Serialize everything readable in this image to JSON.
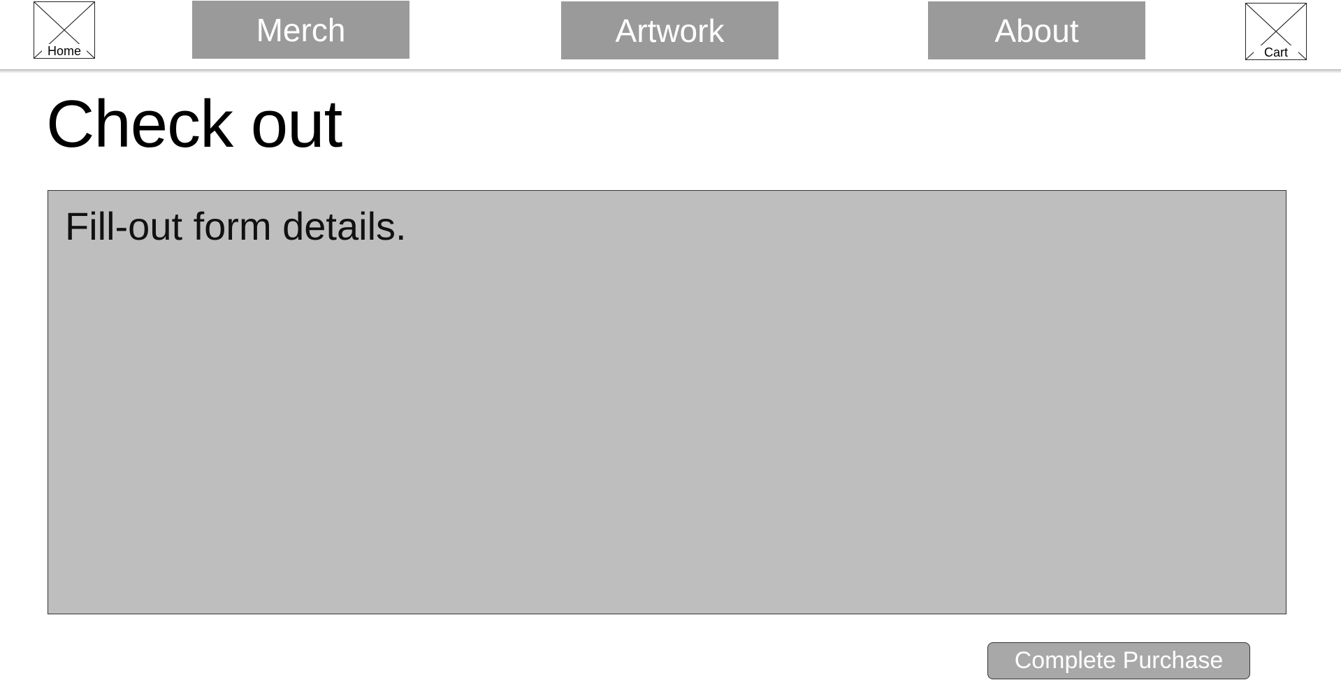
{
  "header": {
    "home_label": "Home",
    "cart_label": "Cart",
    "nav": {
      "merch": "Merch",
      "artwork": "Artwork",
      "about": "About"
    }
  },
  "main": {
    "title": "Check out",
    "form_panel": {
      "instructions": "Fill-out form details."
    },
    "purchase_button_label": "Complete Purchase"
  },
  "colors": {
    "nav_button": "#9a9a9a",
    "form_panel": "#bebebe",
    "purchase_button": "#a8a8a8",
    "text": "#000000",
    "button_text": "#ffffff"
  },
  "icons": {
    "home": "image-placeholder-icon",
    "cart": "image-placeholder-icon"
  }
}
